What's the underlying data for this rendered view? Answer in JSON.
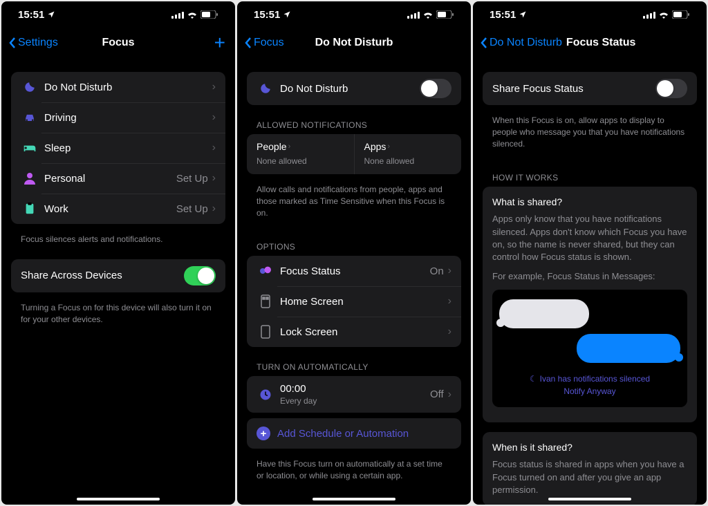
{
  "status": {
    "time": "15:51"
  },
  "screen1": {
    "back": "Settings",
    "title": "Focus",
    "modes": [
      {
        "label": "Do Not Disturb",
        "detail": ""
      },
      {
        "label": "Driving",
        "detail": ""
      },
      {
        "label": "Sleep",
        "detail": ""
      },
      {
        "label": "Personal",
        "detail": "Set Up"
      },
      {
        "label": "Work",
        "detail": "Set Up"
      }
    ],
    "footer1": "Focus silences alerts and notifications.",
    "shareLabel": "Share Across Devices",
    "footer2": "Turning a Focus on for this device will also turn it on for your other devices."
  },
  "screen2": {
    "back": "Focus",
    "title": "Do Not Disturb",
    "toggleLabel": "Do Not Disturb",
    "allowedHeader": "ALLOWED NOTIFICATIONS",
    "peopleLabel": "People",
    "peopleSub": "None allowed",
    "appsLabel": "Apps",
    "appsSub": "None allowed",
    "allowFooter": "Allow calls and notifications from people, apps and those marked as Time Sensitive when this Focus is on.",
    "optionsHeader": "OPTIONS",
    "focusStatusLabel": "Focus Status",
    "focusStatusValue": "On",
    "homeScreenLabel": "Home Screen",
    "lockScreenLabel": "Lock Screen",
    "autoHeader": "TURN ON AUTOMATICALLY",
    "scheduleTime": "00:00",
    "scheduleSub": "Every day",
    "scheduleState": "Off",
    "addScheduleLabel": "Add Schedule or Automation",
    "autoFooter": "Have this Focus turn on automatically at a set time or location, or while using a certain app."
  },
  "screen3": {
    "back": "Do Not Disturb",
    "title": "Focus Status",
    "shareLabel": "Share Focus Status",
    "shareFooter": "When this Focus is on, allow apps to display to people who message you that you have notifications silenced.",
    "howHeader": "HOW IT WORKS",
    "whatTitle": "What is shared?",
    "whatText": "Apps only know that you have notifications silenced. Apps don't know which Focus you have on, so the name is never shared, but they can control how Focus status is shown.",
    "example": "For example, Focus Status in Messages:",
    "silencedLine": "Ivan has notifications silenced",
    "notifyAnyway": "Notify Anyway",
    "whenTitle": "When is it shared?",
    "whenText": "Focus status is shared in apps when you have a Focus turned on and after you give an app permission."
  }
}
